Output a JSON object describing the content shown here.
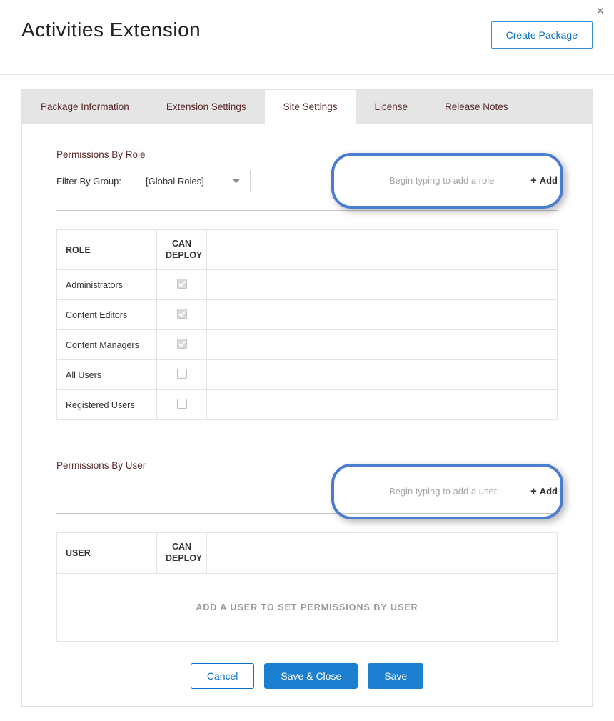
{
  "header": {
    "title": "Activities Extension",
    "create_button": "Create Package"
  },
  "tabs": [
    {
      "label": "Package Information",
      "active": false
    },
    {
      "label": "Extension Settings",
      "active": false
    },
    {
      "label": "Site Settings",
      "active": true
    },
    {
      "label": "License",
      "active": false
    },
    {
      "label": "Release Notes",
      "active": false
    }
  ],
  "roles_section": {
    "title": "Permissions By Role",
    "filter_label": "Filter By Group:",
    "dropdown_value": "[Global Roles]",
    "add_placeholder": "Begin typing to add a role",
    "add_label": "Add",
    "columns": {
      "role": "ROLE",
      "can_deploy_line1": "CAN",
      "can_deploy_line2": "DEPLOY"
    },
    "rows": [
      {
        "name": "Administrators",
        "checked": true,
        "locked": true
      },
      {
        "name": "Content Editors",
        "checked": true,
        "locked": true
      },
      {
        "name": "Content Managers",
        "checked": true,
        "locked": true
      },
      {
        "name": "All Users",
        "checked": false,
        "locked": false
      },
      {
        "name": "Registered Users",
        "checked": false,
        "locked": false
      }
    ]
  },
  "users_section": {
    "title": "Permissions By User",
    "add_placeholder": "Begin typing to add a user",
    "add_label": "Add",
    "columns": {
      "user": "USER",
      "can_deploy_line1": "CAN",
      "can_deploy_line2": "DEPLOY"
    },
    "empty_message": "ADD A USER TO SET PERMISSIONS BY USER"
  },
  "footer": {
    "cancel": "Cancel",
    "save_close": "Save & Close",
    "save": "Save"
  }
}
